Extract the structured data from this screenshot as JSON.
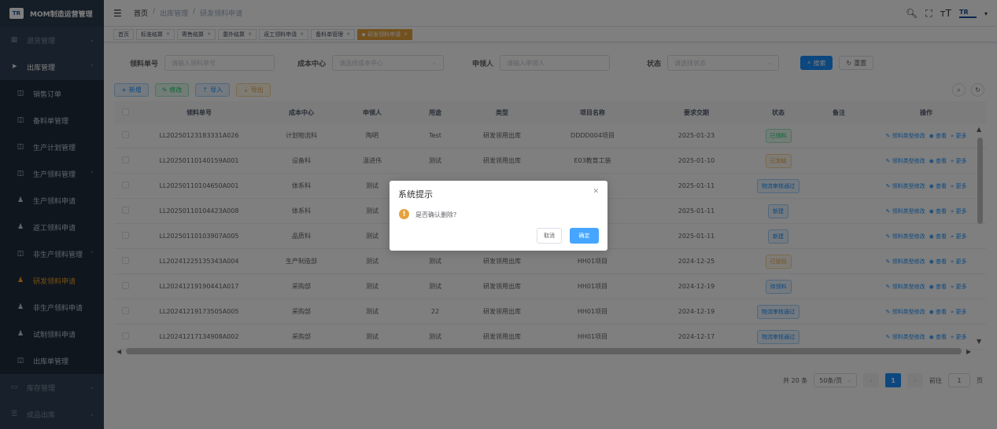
{
  "app": {
    "title": "MOM制造运营管理",
    "logo": "TR"
  },
  "sidebar": {
    "items": [
      {
        "label": "退货管理",
        "icon": "grid-icon",
        "arrow": "⌄"
      },
      {
        "label": "出库管理",
        "icon": "send-icon",
        "arrow": "⌃"
      },
      {
        "label": "销售订单",
        "icon": "square-icon"
      },
      {
        "label": "备料单管理",
        "icon": "square-icon"
      },
      {
        "label": "生产计划管理",
        "icon": "square-icon"
      },
      {
        "label": "生产领料管理",
        "icon": "square-icon",
        "arrow": "⌃"
      },
      {
        "label": "生产领料申请",
        "icon": "user-icon"
      },
      {
        "label": "返工领料申请",
        "icon": "user-icon"
      },
      {
        "label": "非生产领料管理",
        "icon": "square-icon",
        "arrow": "⌃"
      },
      {
        "label": "研发领料申请",
        "icon": "user-icon"
      },
      {
        "label": "非生产领料申请",
        "icon": "user-icon"
      },
      {
        "label": "试制领料申请",
        "icon": "user-icon"
      },
      {
        "label": "出库单管理",
        "icon": "square-icon"
      },
      {
        "label": "库存管理",
        "icon": "monitor-icon",
        "arrow": "⌄"
      },
      {
        "label": "成品出库",
        "icon": "list-icon",
        "arrow": "⌄"
      }
    ]
  },
  "header": {
    "breadcrumb": [
      "首页",
      "/",
      "出库管理",
      "/",
      "研发领料申请"
    ],
    "brand": "TR"
  },
  "tags": [
    {
      "label": "首页"
    },
    {
      "label": "标准结算"
    },
    {
      "label": "寄售结算"
    },
    {
      "label": "委外结算"
    },
    {
      "label": "返工领料申请"
    },
    {
      "label": "备料单管理"
    },
    {
      "label": "研发领料申请"
    }
  ],
  "search": {
    "code_label": "领料单号",
    "code_placeholder": "请输入领料单号",
    "cost_label": "成本中心",
    "cost_placeholder": "请选择成本中心",
    "applicant_label": "申领人",
    "applicant_placeholder": "请输入申领人",
    "status_label": "状态",
    "status_placeholder": "请选择状态",
    "search_btn": "搜索",
    "reset_btn": "重置"
  },
  "toolbar": {
    "add": "新增",
    "edit": "修改",
    "import": "导入",
    "export": "导出"
  },
  "table": {
    "headers": [
      "领料单号",
      "成本中心",
      "申领人",
      "用途",
      "类型",
      "项目名称",
      "要求交期",
      "状态",
      "备注",
      "操作"
    ],
    "rows": [
      [
        "LL20250123183331A026",
        "计划物流科",
        "陶明",
        "Test",
        "研发领用出库",
        "DDDD004项目",
        "2025-01-23",
        "已领料",
        ""
      ],
      [
        "LL20250110140159A001",
        "设备科",
        "温进伟",
        "测试",
        "研发领用出库",
        "E03教育工装",
        "2025-01-10",
        "已冻结",
        ""
      ],
      [
        "LL20250110104650A001",
        "体系科",
        "测试",
        "",
        "",
        "",
        "2025-01-11",
        "物流审核通过",
        ""
      ],
      [
        "LL20250110104423A008",
        "体系科",
        "测试",
        "",
        "",
        "",
        "2025-01-11",
        "新建",
        ""
      ],
      [
        "LL20250110103907A005",
        "品质科",
        "测试",
        "",
        "",
        "",
        "2025-01-11",
        "新建",
        ""
      ],
      [
        "LL20241225135343A004",
        "生产制造部",
        "测试",
        "测试",
        "研发领用出库",
        "HH01项目",
        "2024-12-25",
        "已驳回",
        ""
      ],
      [
        "LL20241219190441A017",
        "采购部",
        "测试",
        "测试",
        "研发领用出库",
        "HH01项目",
        "2024-12-19",
        "待领料",
        ""
      ],
      [
        "LL20241219173505A005",
        "采购部",
        "测试",
        "22",
        "研发领用出库",
        "HH01项目",
        "2024-12-19",
        "物流审核通过",
        ""
      ],
      [
        "LL20241217134908A002",
        "采购部",
        "测试",
        "测试",
        "研发领用出库",
        "HH01项目",
        "2024-12-17",
        "物流审核通过",
        ""
      ]
    ],
    "ops": [
      "领料类型修改",
      "查看",
      "更多"
    ]
  },
  "pager": {
    "total": "共 20 条",
    "size": "50条/页",
    "current": "1",
    "goto_label": "前往",
    "goto_value": "1",
    "page_suffix": "页"
  },
  "dialog": {
    "title": "系统提示",
    "message": "是否确认删除?",
    "cancel": "取消",
    "ok": "确定"
  }
}
